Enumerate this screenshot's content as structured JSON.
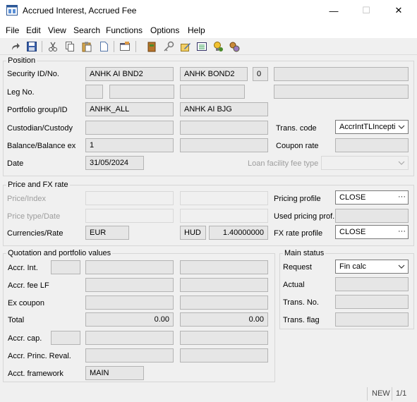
{
  "window": {
    "title": "Accrued Interest, Accrued Fee",
    "minimize_glyph": "—",
    "maximize_glyph": "☐",
    "close_glyph": "✕"
  },
  "menu": [
    "File",
    "Edit",
    "View",
    "Search",
    "Functions",
    "Options",
    "Help"
  ],
  "toolbar": [
    "redo-icon",
    "save-icon",
    "cut-icon",
    "copy-icon",
    "paste-icon",
    "new-document-icon",
    "properties-icon",
    "book-icon",
    "key-icon",
    "edit-icon",
    "list-icon",
    "bulb-icon",
    "settings-icon"
  ],
  "position": {
    "legend": "Position",
    "security_label": "Security ID/No.",
    "security_id": "ANHK AI BND2",
    "security_name": "ANHK BOND2",
    "security_no": "0",
    "security_extra": "",
    "leg_label": "Leg No.",
    "leg_no": "",
    "leg_f2": "",
    "leg_f3": "",
    "leg_f4": "",
    "portfolio_label": "Portfolio group/ID",
    "portfolio_group": "ANHK_ALL",
    "portfolio_id": "ANHK AI BJG",
    "custodian_label": "Custodian/Custody",
    "custodian": "",
    "custody": "",
    "trans_code_label": "Trans. code",
    "trans_code": "AccrIntTLIncepti",
    "balance_label": "Balance/Balance ex",
    "balance": "1",
    "balance_ex": "",
    "coupon_rate_label": "Coupon rate",
    "coupon_rate": "",
    "date_label": "Date",
    "date": "31/05/2024",
    "loan_fee_label": "Loan facility fee type",
    "loan_fee_type": ""
  },
  "price_fx": {
    "legend": "Price and FX rate",
    "price_label": "Price/Index",
    "price": "",
    "index": "",
    "pricing_profile_label": "Pricing profile",
    "pricing_profile": "CLOSE",
    "price_type_label": "Price type/Date",
    "price_type": "",
    "price_date": "",
    "used_pricing_label": "Used pricing prof.",
    "used_pricing": "",
    "currencies_label": "Currencies/Rate",
    "currency": "EUR",
    "ref_currency": "HUD",
    "rate": "1.40000000",
    "fx_profile_label": "FX rate profile",
    "fx_profile": "CLOSE",
    "dots": "···"
  },
  "quotation": {
    "legend": "Quotation and portfolio values",
    "accr_int_label": "Accr. Int.",
    "accr_int_ccy": "",
    "accr_int": "",
    "accr_int_port": "",
    "accr_fee_label": "Accr. fee LF",
    "accr_fee": "",
    "accr_fee_port": "",
    "ex_coupon_label": "Ex coupon",
    "ex_coupon": "",
    "ex_coupon_port": "",
    "total_label": "Total",
    "total": "0.00",
    "total_port": "0.00",
    "accr_cap_label": "Accr. cap.",
    "accr_cap_ccy": "",
    "accr_cap": "",
    "accr_cap_port": "",
    "reval_label": "Accr. Princ. Reval.",
    "reval": "",
    "reval_port": "",
    "framework_label": "Acct. framework",
    "framework": "MAIN"
  },
  "main_status": {
    "legend": "Main status",
    "request_label": "Request",
    "request": "Fin calc",
    "actual_label": "Actual",
    "actual": "",
    "trans_no_label": "Trans. No.",
    "trans_no": "",
    "trans_flag_label": "Trans. flag",
    "trans_flag": ""
  },
  "status_bar": {
    "mode": "NEW",
    "record": "1/1"
  }
}
